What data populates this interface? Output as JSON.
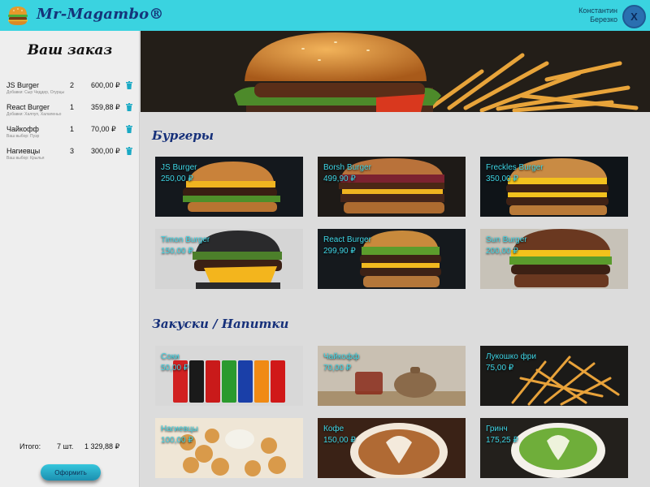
{
  "header": {
    "brand": "Mr-Magambo®",
    "user_line1": "Константин",
    "user_line2": "Березко",
    "logout_label": "X"
  },
  "order": {
    "title": "Ваш заказ",
    "items": [
      {
        "name": "JS Burger",
        "qty": "2",
        "price": "600,00 ₽",
        "note": "Добавки: Сыр Чеддер, Огурцы"
      },
      {
        "name": "React Burger",
        "qty": "1",
        "price": "359,88 ₽",
        "note": "Добавки: Халпуп, Халапеньо"
      },
      {
        "name": "Чайкофф",
        "qty": "1",
        "price": "70,00 ₽",
        "note": "Ваш выбор: Пуэр"
      },
      {
        "name": "Нагиевцы",
        "qty": "3",
        "price": "300,00 ₽",
        "note": "Ваш выбор: Крылья"
      }
    ],
    "total_label": "Итого:",
    "total_qty": "7 шт.",
    "total_sum": "1 329,88 ₽",
    "checkout_label": "Оформить"
  },
  "sections": {
    "burgers": {
      "title": "Бургеры",
      "items": [
        {
          "name": "JS Burger",
          "price": "250,00 ₽"
        },
        {
          "name": "Borsh Burger",
          "price": "499,90 ₽"
        },
        {
          "name": "Freckles Burger",
          "price": "350,00 ₽"
        },
        {
          "name": "Timon Burger",
          "price": "150,00 ₽"
        },
        {
          "name": "React Burger",
          "price": "299,90 ₽"
        },
        {
          "name": "Sun Burger",
          "price": "200,00 ₽"
        }
      ]
    },
    "snacks": {
      "title": "Закуски / Напитки",
      "items": [
        {
          "name": "Соки",
          "price": "50,00 ₽"
        },
        {
          "name": "Чайкофф",
          "price": "70,00 ₽"
        },
        {
          "name": "Лукошко фри",
          "price": "75,00 ₽"
        },
        {
          "name": "Нагиевцы",
          "price": "100,00 ₽"
        },
        {
          "name": "Кофе",
          "price": "150,00 ₽"
        },
        {
          "name": "Гринч",
          "price": "175,25 ₽"
        }
      ]
    }
  },
  "colors": {
    "header": "#3ad3e0",
    "accent_text": "#3fd6e6",
    "title_text": "#16307a"
  }
}
